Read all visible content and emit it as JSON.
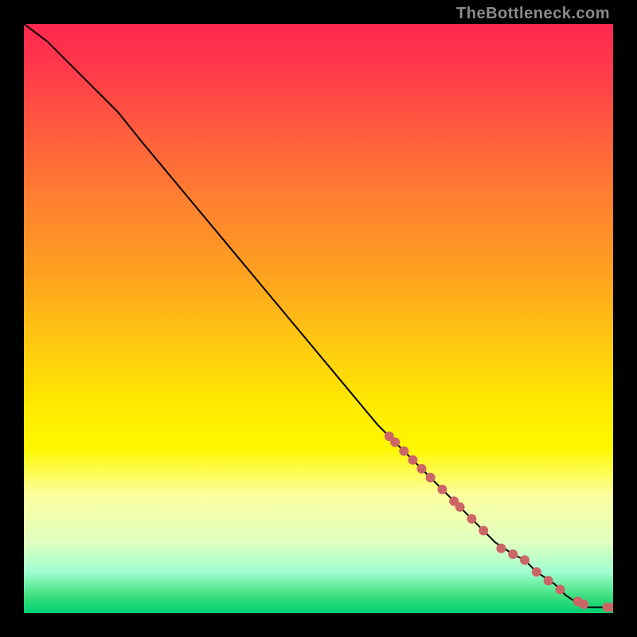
{
  "watermark": "TheBottleneck.com",
  "chart_data": {
    "type": "line",
    "title": "",
    "xlabel": "",
    "ylabel": "",
    "xlim": [
      0,
      100
    ],
    "ylim": [
      0,
      100
    ],
    "series": [
      {
        "name": "curve",
        "x": [
          0,
          4,
          8,
          12,
          16,
          20,
          25,
          30,
          35,
          40,
          45,
          50,
          55,
          60,
          63,
          65,
          68,
          70,
          72,
          74,
          76,
          78,
          80,
          83,
          85,
          87,
          90,
          92,
          95,
          98,
          100
        ],
        "y": [
          100,
          97,
          93,
          89,
          85,
          80,
          74,
          68,
          62,
          56,
          50,
          44,
          38,
          32,
          29,
          27,
          24,
          22,
          20,
          18,
          16,
          14,
          12,
          10,
          9,
          7,
          5,
          3,
          1,
          1,
          1
        ]
      }
    ],
    "markers": [
      {
        "x": 62,
        "y": 30
      },
      {
        "x": 63,
        "y": 29
      },
      {
        "x": 64.5,
        "y": 27.5
      },
      {
        "x": 66,
        "y": 26
      },
      {
        "x": 67.5,
        "y": 24.5
      },
      {
        "x": 69,
        "y": 23
      },
      {
        "x": 71,
        "y": 21
      },
      {
        "x": 73,
        "y": 19
      },
      {
        "x": 74,
        "y": 18
      },
      {
        "x": 76,
        "y": 16
      },
      {
        "x": 78,
        "y": 14
      },
      {
        "x": 81,
        "y": 11
      },
      {
        "x": 83,
        "y": 10
      },
      {
        "x": 85,
        "y": 9
      },
      {
        "x": 87,
        "y": 7
      },
      {
        "x": 89,
        "y": 5.5
      },
      {
        "x": 91,
        "y": 4
      },
      {
        "x": 94,
        "y": 2
      },
      {
        "x": 95,
        "y": 1.5
      },
      {
        "x": 99,
        "y": 1
      },
      {
        "x": 100,
        "y": 1
      }
    ]
  }
}
